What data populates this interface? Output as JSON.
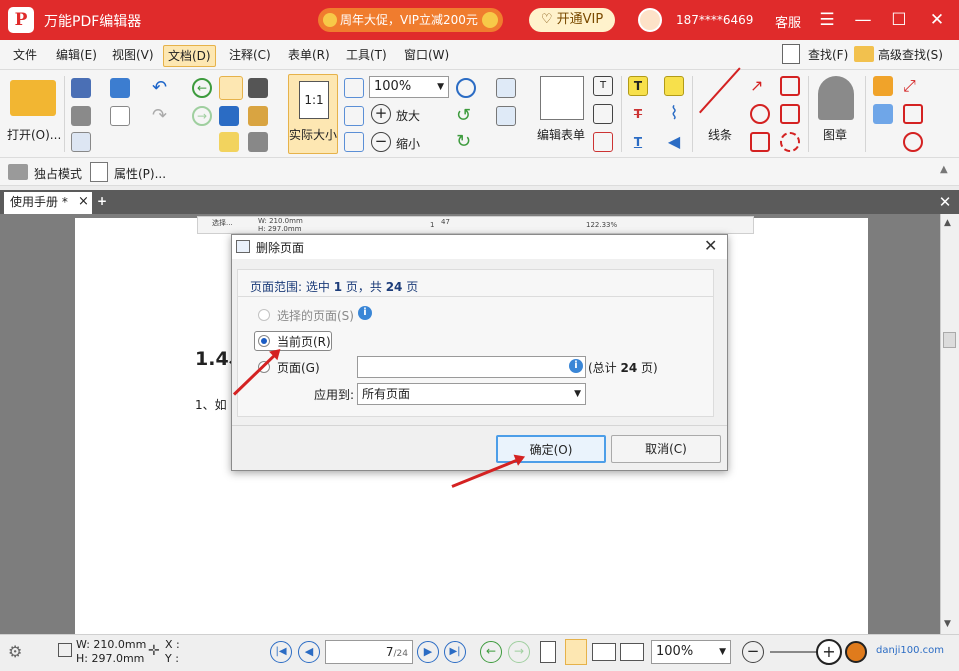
{
  "titlebar": {
    "app_title": "万能PDF编辑器",
    "logo_letter": "P",
    "promo_text": "周年大促，VIP立减200元",
    "vip_label": "开通VIP",
    "phone": "187****6469",
    "service_label": "客服"
  },
  "menu": [
    "文件",
    "编辑(E)",
    "视图(V)",
    "文档(D)",
    "注释(C)",
    "表单(R)",
    "工具(T)",
    "窗口(W)"
  ],
  "menu_right": {
    "find": "查找(F)",
    "advanced_find": "高级查找(S)"
  },
  "toolbar": {
    "open_label": "打开(O)...",
    "actual_size_label": "实际大小",
    "zoom_value": "100%",
    "zoom_in_label": "放大",
    "zoom_out_label": "缩小",
    "edit_form_label": "编辑表单",
    "lines_label": "线条",
    "stamp_label": "图章"
  },
  "subbar": {
    "exclusive_mode": "独占模式",
    "properties": "属性(P)..."
  },
  "tab": {
    "title": "使用手册 *",
    "close": "×",
    "add": "+"
  },
  "document": {
    "heading": "1.4、",
    "line1": "1、如"
  },
  "mini_toolbar": {
    "select_label": "选择...",
    "w": "W: 210.0mm",
    "h": "H: 297.0mm",
    "page": "1",
    "total": "47",
    "zoom": "122.33%"
  },
  "dialog": {
    "title": "删除页面",
    "range_prefix": "页面范围: 选中 ",
    "range_selected": "1",
    "range_mid": " 页，共 ",
    "range_total": "24",
    "range_suffix": " 页",
    "opt_selected_pages": "选择的页面(S)",
    "opt_current_page": "当前页(R)",
    "opt_pages": "页面(G)",
    "pages_input_value": "",
    "total_prefix": "(总计 ",
    "total_value": "24",
    "total_suffix": " 页)",
    "apply_to_label": "应用到:",
    "apply_to_value": "所有页面",
    "ok_label": "确定(O)",
    "cancel_label": "取消(C)"
  },
  "statusbar": {
    "w": "W: 210.0mm",
    "h": "H: 297.0mm",
    "x": "X :",
    "y": "Y :",
    "page_current": "7",
    "page_total": "/24",
    "zoom": "100%",
    "watermark": "danji100.com"
  },
  "colors": {
    "title_bg": "#e02b2b",
    "accent_blue": "#1b5cc4",
    "arrow_red": "#d42222"
  }
}
